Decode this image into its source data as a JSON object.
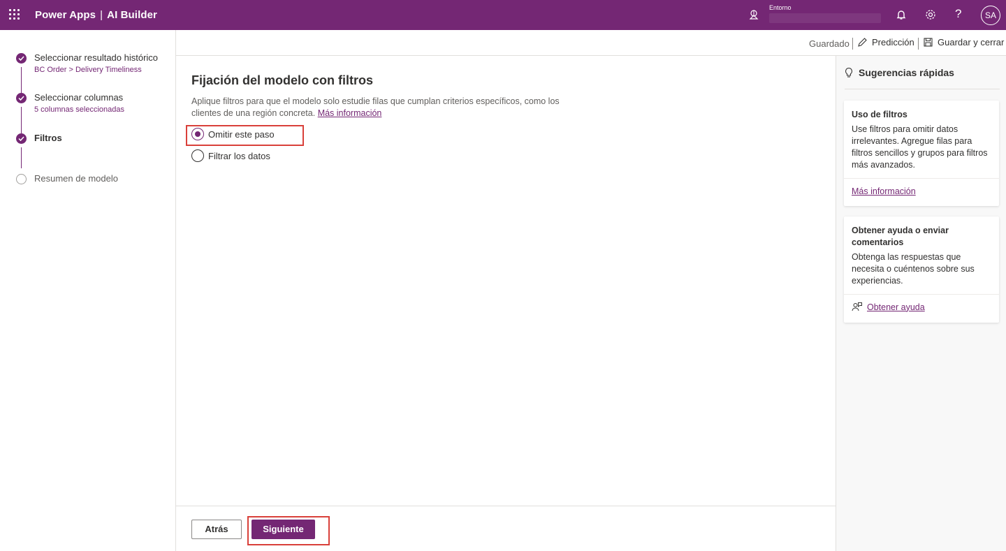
{
  "topbar": {
    "app_name": "Power Apps",
    "separator": "|",
    "product": "AI Builder",
    "env_label": "Entorno",
    "env_name": "",
    "help_glyph": "?",
    "avatar_initials": "SA",
    "icons": [
      "app-launcher-icon",
      "environment-icon",
      "notifications-icon",
      "settings-icon",
      "help-icon"
    ]
  },
  "commandbar": {
    "status": "Guardado",
    "prediction_label": "Predicción",
    "save_close_label": "Guardar y cerrar"
  },
  "steps": [
    {
      "title": "Seleccionar resultado histórico",
      "subtitle": "BC Order > Delivery Timeliness",
      "state": "done"
    },
    {
      "title": "Seleccionar columnas",
      "subtitle": "5 columnas seleccionadas",
      "state": "done"
    },
    {
      "title": "Filtros",
      "subtitle": "",
      "state": "current"
    },
    {
      "title": "Resumen de modelo",
      "subtitle": "",
      "state": "todo"
    }
  ],
  "main": {
    "heading": "Fijación del modelo con filtros",
    "description": "Aplique filtros para que el modelo solo estudie filas que cumplan criterios específicos, como los clientes de una región concreta.",
    "learn_more": "Más información",
    "options": [
      {
        "label": "Omitir este paso",
        "selected": true
      },
      {
        "label": "Filtrar los datos",
        "selected": false
      }
    ]
  },
  "footer": {
    "back_label": "Atrás",
    "next_label": "Siguiente"
  },
  "tips": {
    "title": "Sugerencias rápidas",
    "cards": [
      {
        "title": "Uso de filtros",
        "body": "Use filtros para omitir datos irrelevantes. Agregue filas para filtros sencillos y grupos para filtros más avanzados.",
        "link": "Más información"
      },
      {
        "title": "Obtener ayuda o enviar comentarios",
        "body": "Obtenga las respuestas que necesita o cuéntenos sobre sus experiencias.",
        "link": "Obtener ayuda"
      }
    ]
  },
  "colors": {
    "brand": "#742774",
    "highlight": "#d9403a",
    "border": "#e1dfdd"
  }
}
